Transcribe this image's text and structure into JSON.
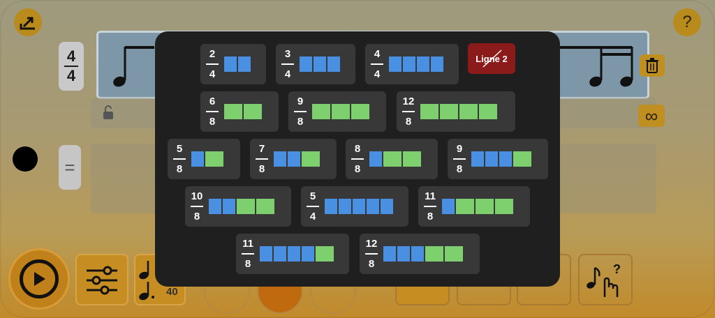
{
  "header": {
    "help_label": "?"
  },
  "staff": {
    "time_top": "4",
    "time_bottom": "4"
  },
  "tempo": {
    "value": "40"
  },
  "equals": "=",
  "infinity": "∞",
  "modal": {
    "ligne_label": "Ligne 2",
    "rows": [
      [
        {
          "num": "2",
          "den": "4",
          "blocks": [
            "blue",
            "blue"
          ]
        },
        {
          "num": "3",
          "den": "4",
          "blocks": [
            "blue",
            "blue",
            "blue"
          ]
        },
        {
          "num": "4",
          "den": "4",
          "blocks": [
            "blue",
            "blue",
            "blue",
            "blue"
          ]
        }
      ],
      [
        {
          "num": "6",
          "den": "8",
          "blocks": [
            "green",
            "green"
          ]
        },
        {
          "num": "9",
          "den": "8",
          "blocks": [
            "green",
            "green",
            "green"
          ]
        },
        {
          "num": "12",
          "den": "8",
          "blocks": [
            "green",
            "green",
            "green",
            "green"
          ]
        }
      ],
      [
        {
          "num": "5",
          "den": "8",
          "blocks": [
            "blue",
            "green"
          ]
        },
        {
          "num": "7",
          "den": "8",
          "blocks": [
            "blue",
            "blue",
            "green"
          ]
        },
        {
          "num": "8",
          "den": "8",
          "blocks": [
            "blue",
            "green",
            "green"
          ]
        },
        {
          "num": "9",
          "den": "8",
          "blocks": [
            "blue",
            "blue",
            "blue",
            "green"
          ]
        }
      ],
      [
        {
          "num": "10",
          "den": "8",
          "blocks": [
            "blue",
            "blue",
            "green",
            "green"
          ]
        },
        {
          "num": "5",
          "den": "4",
          "blocks": [
            "blue",
            "blue",
            "blue",
            "blue",
            "blue"
          ]
        },
        {
          "num": "11",
          "den": "8",
          "blocks": [
            "blue",
            "green",
            "green",
            "green"
          ]
        }
      ],
      [
        {
          "num": "11",
          "den": "8",
          "blocks": [
            "blue",
            "blue",
            "blue",
            "blue",
            "green"
          ]
        },
        {
          "num": "12",
          "den": "8",
          "blocks": [
            "blue",
            "blue",
            "blue",
            "green",
            "green"
          ]
        }
      ]
    ]
  }
}
